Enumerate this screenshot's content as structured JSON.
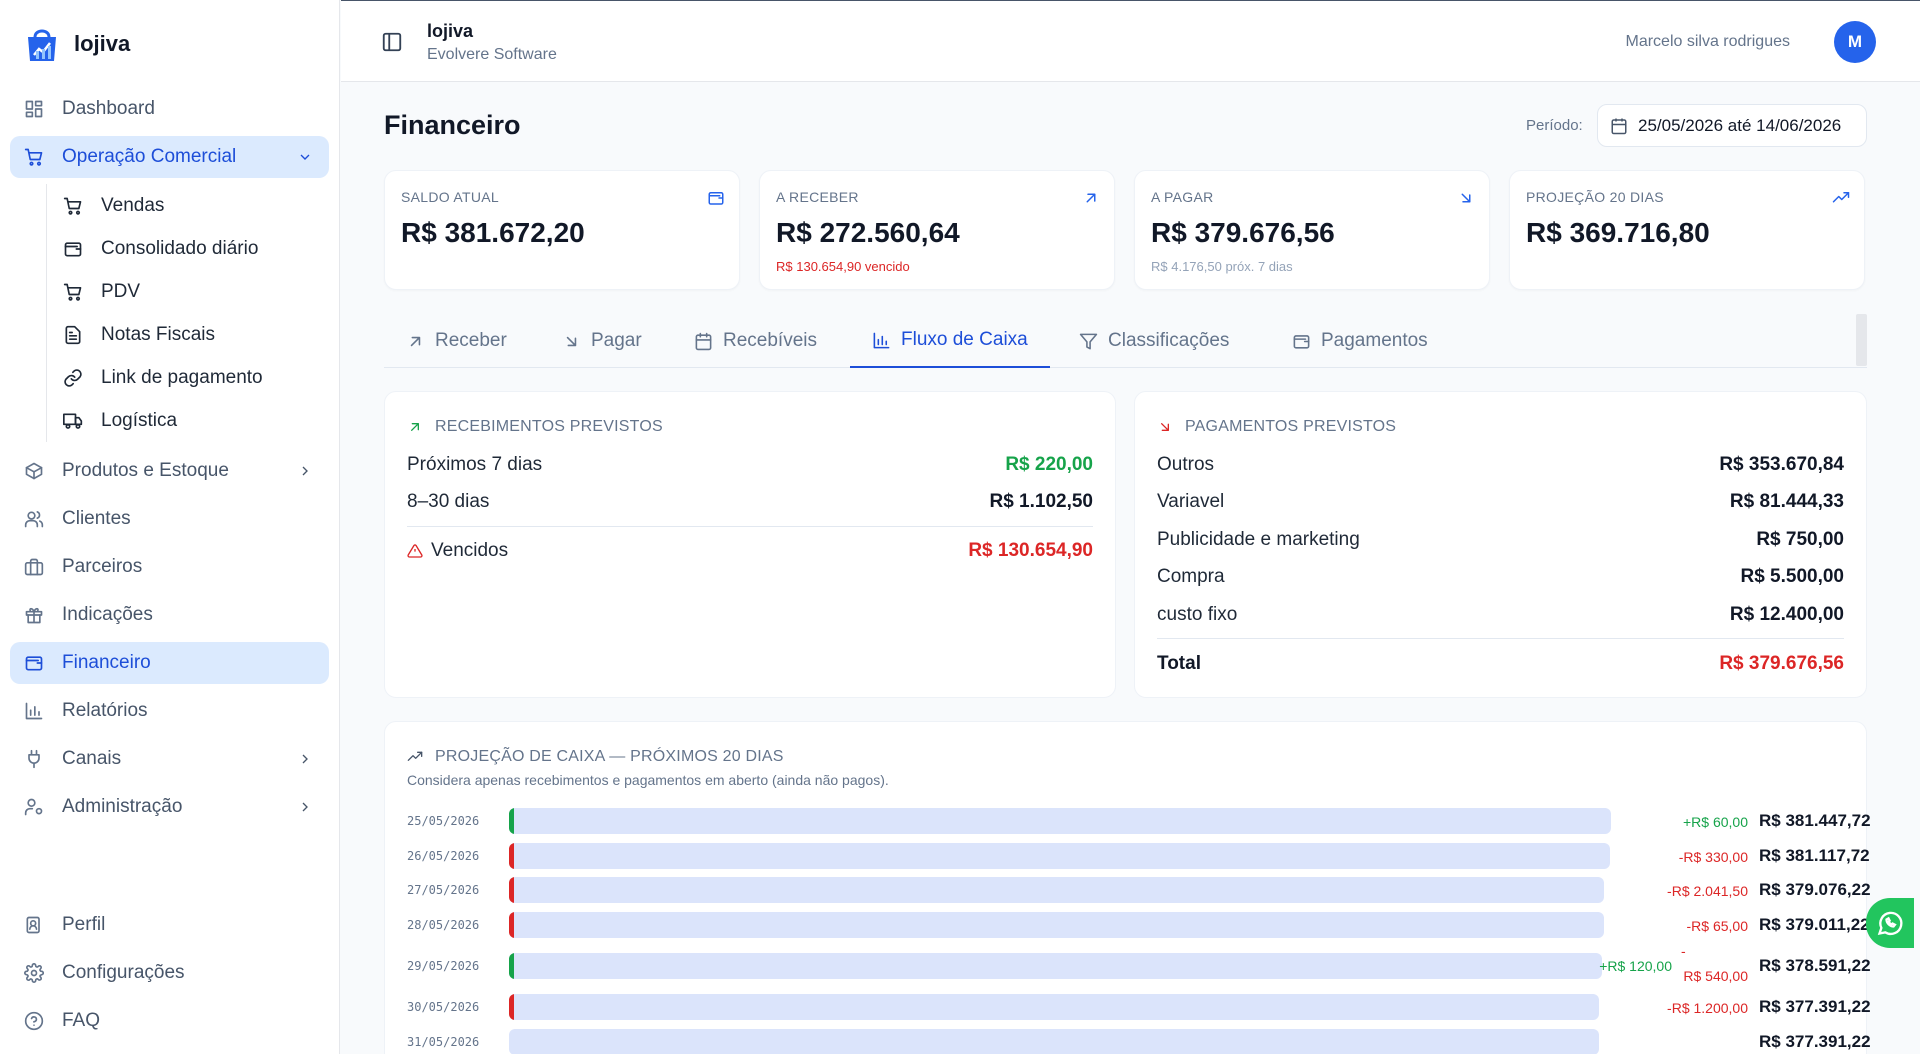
{
  "app": {
    "name": "lojiva"
  },
  "sidebar": {
    "items": [
      {
        "label": "Dashboard",
        "icon": "dashboard-icon"
      },
      {
        "label": "Operação Comercial",
        "icon": "cart-icon"
      },
      {
        "label": "Produtos e Estoque",
        "icon": "box-icon"
      },
      {
        "label": "Clientes",
        "icon": "users-icon"
      },
      {
        "label": "Parceiros",
        "icon": "briefcase-icon"
      },
      {
        "label": "Indicações",
        "icon": "gift-icon"
      },
      {
        "label": "Financeiro",
        "icon": "wallet-icon"
      },
      {
        "label": "Relatórios",
        "icon": "bar-chart-icon"
      },
      {
        "label": "Canais",
        "icon": "plug-icon"
      },
      {
        "label": "Administração",
        "icon": "user-cog-icon"
      }
    ],
    "sub_items": [
      {
        "label": "Vendas",
        "icon": "cart-icon"
      },
      {
        "label": "Consolidado diário",
        "icon": "wallet-icon"
      },
      {
        "label": "PDV",
        "icon": "cart-icon"
      },
      {
        "label": "Notas Fiscais",
        "icon": "file-icon"
      },
      {
        "label": "Link de pagamento",
        "icon": "link-icon"
      },
      {
        "label": "Logística",
        "icon": "truck-icon"
      }
    ],
    "bottom": [
      {
        "label": "Perfil",
        "icon": "id-card-icon"
      },
      {
        "label": "Configurações",
        "icon": "gear-icon"
      },
      {
        "label": "FAQ",
        "icon": "help-icon"
      }
    ]
  },
  "topbar": {
    "title": "lojiva",
    "subtitle": "Evolvere Software",
    "user": "Marcelo silva rodrigues",
    "avatar": "M"
  },
  "page": {
    "title": "Financeiro",
    "period_label": "Período:",
    "period_value": "25/05/2026 até 14/06/2026"
  },
  "kpis": [
    {
      "label": "SALDO ATUAL",
      "value": "R$ 381.672,20",
      "note": ""
    },
    {
      "label": "A RECEBER",
      "value": "R$ 272.560,64",
      "note": "R$ 130.654,90 vencido"
    },
    {
      "label": "A PAGAR",
      "value": "R$ 379.676,56",
      "note": "R$ 4.176,50 próx. 7 dias"
    },
    {
      "label": "PROJEÇÃO 20 DIAS",
      "value": "R$ 369.716,80",
      "note": ""
    }
  ],
  "tabs": [
    "Receber",
    "Pagar",
    "Recebíveis",
    "Fluxo de Caixa",
    "Classificações",
    "Pagamentos"
  ],
  "receb": {
    "title": "RECEBIMENTOS PREVISTOS",
    "rows": [
      {
        "label": "Próximos 7 dias",
        "value": "R$ 220,00"
      },
      {
        "label": "8–30 dias",
        "value": "R$ 1.102,50"
      }
    ],
    "overdue_label": "Vencidos",
    "overdue_value": "R$ 130.654,90"
  },
  "pagam": {
    "title": "PAGAMENTOS PREVISTOS",
    "rows": [
      {
        "label": "Outros",
        "value": "R$ 353.670,84"
      },
      {
        "label": "Variavel",
        "value": "R$ 81.444,33"
      },
      {
        "label": "Publicidade e marketing",
        "value": "R$ 750,00"
      },
      {
        "label": "Compra",
        "value": "R$ 5.500,00"
      },
      {
        "label": "custo fixo",
        "value": "R$ 12.400,00"
      }
    ],
    "total_label": "Total",
    "total_value": "R$ 379.676,56"
  },
  "projecao": {
    "title": "PROJEÇÃO DE CAIXA — PRÓXIMOS 20 DIAS",
    "subtitle": "Considera apenas recebimentos e pagamentos em aberto (ainda não pagos).",
    "rows": [
      {
        "date": "25/05/2026",
        "deltas": [
          {
            "text": "+R$ 60,00",
            "kind": "pos"
          }
        ],
        "balance": "R$ 381.447,72",
        "fill": 0.998,
        "mark": "pos"
      },
      {
        "date": "26/05/2026",
        "deltas": [
          {
            "text": "-R$ 330,00",
            "kind": "neg"
          }
        ],
        "balance": "R$ 381.117,72",
        "fill": 0.997,
        "mark": "neg"
      },
      {
        "date": "27/05/2026",
        "deltas": [
          {
            "text": "-R$ 2.041,50",
            "kind": "neg"
          }
        ],
        "balance": "R$ 379.076,22",
        "fill": 0.992,
        "mark": "neg"
      },
      {
        "date": "28/05/2026",
        "deltas": [
          {
            "text": "-R$ 65,00",
            "kind": "neg"
          }
        ],
        "balance": "R$ 379.011,22",
        "fill": 0.992,
        "mark": "neg"
      },
      {
        "date": "29/05/2026",
        "deltas": [
          {
            "text": "+R$ 120,00",
            "kind": "pos"
          },
          {
            "text": "-",
            "kind": "neg"
          },
          {
            "text": "R$ 540,00",
            "kind": "neg"
          }
        ],
        "balance": "R$ 378.591,22",
        "fill": 0.99,
        "mark": "pos"
      },
      {
        "date": "30/05/2026",
        "deltas": [
          {
            "text": "-R$ 1.200,00",
            "kind": "neg"
          }
        ],
        "balance": "R$ 377.391,22",
        "fill": 0.987,
        "mark": "neg"
      },
      {
        "date": "31/05/2026",
        "deltas": [],
        "balance": "R$ 377.391,22",
        "fill": 0.987,
        "mark": ""
      }
    ]
  },
  "colors": {
    "primary": "#1d4ed8",
    "positive": "#16a34a",
    "negative": "#dc2626",
    "bar": "#dbe4fb"
  }
}
